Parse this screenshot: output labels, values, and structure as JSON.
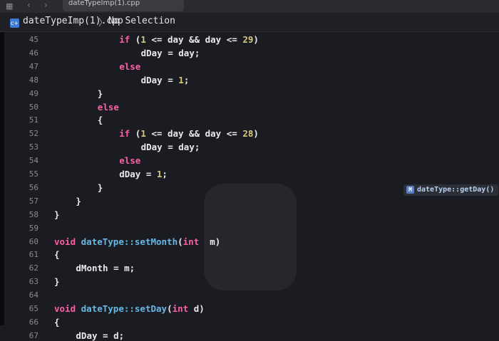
{
  "tab": {
    "title": "dateTypeImp(1).cpp"
  },
  "jump_bar": {
    "file_name": "dateTypeImp(1).cpp",
    "separator": "〉",
    "selection": "No Selection"
  },
  "lines": [
    {
      "n": "45",
      "indent": 12,
      "parts": [
        [
          "kw",
          "if"
        ],
        [
          "t",
          " ("
        ],
        [
          "num",
          "1"
        ],
        [
          "t",
          " <= day && day <= "
        ],
        [
          "num",
          "29"
        ],
        [
          "t",
          ")"
        ]
      ]
    },
    {
      "n": "46",
      "indent": 16,
      "parts": [
        [
          "t",
          "dDay = day;"
        ]
      ]
    },
    {
      "n": "47",
      "indent": 12,
      "parts": [
        [
          "kw",
          "else"
        ]
      ]
    },
    {
      "n": "48",
      "indent": 16,
      "parts": [
        [
          "t",
          "dDay = "
        ],
        [
          "num",
          "1"
        ],
        [
          "t",
          ";"
        ]
      ]
    },
    {
      "n": "49",
      "indent": 8,
      "parts": [
        [
          "t",
          "}"
        ]
      ]
    },
    {
      "n": "50",
      "indent": 8,
      "parts": [
        [
          "kw",
          "else"
        ]
      ]
    },
    {
      "n": "51",
      "indent": 8,
      "parts": [
        [
          "t",
          "{"
        ]
      ]
    },
    {
      "n": "52",
      "indent": 12,
      "parts": [
        [
          "kw",
          "if"
        ],
        [
          "t",
          " ("
        ],
        [
          "num",
          "1"
        ],
        [
          "t",
          " <= day && day <= "
        ],
        [
          "num",
          "28"
        ],
        [
          "t",
          ")"
        ]
      ]
    },
    {
      "n": "53",
      "indent": 16,
      "parts": [
        [
          "t",
          "dDay = day;"
        ]
      ]
    },
    {
      "n": "54",
      "indent": 12,
      "parts": [
        [
          "kw",
          "else"
        ]
      ]
    },
    {
      "n": "55",
      "indent": 12,
      "parts": [
        [
          "t",
          "dDay = "
        ],
        [
          "num",
          "1"
        ],
        [
          "t",
          ";"
        ]
      ]
    },
    {
      "n": "56",
      "indent": 8,
      "parts": [
        [
          "t",
          "}"
        ]
      ]
    },
    {
      "n": "57",
      "indent": 4,
      "parts": [
        [
          "t",
          "}"
        ]
      ]
    },
    {
      "n": "58",
      "indent": 0,
      "parts": [
        [
          "t",
          "}"
        ]
      ]
    },
    {
      "n": "59",
      "indent": 0,
      "parts": []
    },
    {
      "n": "60",
      "indent": 0,
      "parts": [
        [
          "kw",
          "void"
        ],
        [
          "t",
          " "
        ],
        [
          "fn",
          "dateType::setMonth"
        ],
        [
          "t",
          "("
        ],
        [
          "kw",
          "int"
        ],
        [
          "t",
          "  m)"
        ]
      ]
    },
    {
      "n": "61",
      "indent": 0,
      "parts": [
        [
          "t",
          "{"
        ]
      ]
    },
    {
      "n": "62",
      "indent": 4,
      "parts": [
        [
          "t",
          "dMonth = m;"
        ]
      ]
    },
    {
      "n": "63",
      "indent": 0,
      "parts": [
        [
          "t",
          "}"
        ]
      ]
    },
    {
      "n": "64",
      "indent": 0,
      "parts": []
    },
    {
      "n": "65",
      "indent": 0,
      "parts": [
        [
          "kw",
          "void"
        ],
        [
          "t",
          " "
        ],
        [
          "fn",
          "dateType::setDay"
        ],
        [
          "t",
          "("
        ],
        [
          "kw",
          "int"
        ],
        [
          "t",
          " d)"
        ]
      ]
    },
    {
      "n": "66",
      "indent": 0,
      "parts": [
        [
          "t",
          "{"
        ]
      ]
    },
    {
      "n": "67",
      "indent": 4,
      "parts": [
        [
          "t",
          "dDay = d;"
        ]
      ]
    }
  ],
  "minimap_hint": {
    "badge": "M",
    "label": "dateType::getDay()"
  },
  "colors": {
    "background": "#1b1c21",
    "keyword": "#fc5fa3",
    "number": "#d9c97c",
    "function": "#67b7e4",
    "text": "#e9e9eb",
    "line_number": "#8a8b90"
  }
}
